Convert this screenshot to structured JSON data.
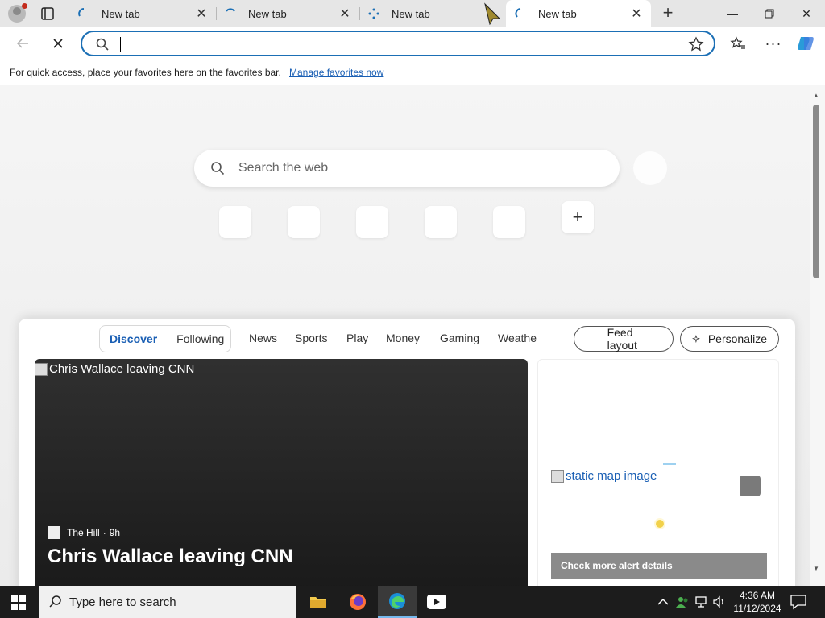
{
  "tabs": [
    {
      "label": "New tab",
      "active": false
    },
    {
      "label": "New tab",
      "active": false
    },
    {
      "label": "New tab",
      "active": false
    },
    {
      "label": "New tab",
      "active": true
    }
  ],
  "address_bar": {
    "value": "",
    "placeholder": ""
  },
  "favorites_bar": {
    "message": "For quick access, place your favorites here on the favorites bar.",
    "link": "Manage favorites now"
  },
  "newtab": {
    "search_placeholder": "Search the web"
  },
  "feed": {
    "primary_tabs": [
      {
        "label": "Discover",
        "selected": true
      },
      {
        "label": "Following",
        "selected": false
      }
    ],
    "tabs": [
      "News",
      "Sports",
      "Play",
      "Money",
      "Gaming",
      "Weathe"
    ],
    "feed_layout_button": "Feed layout",
    "personalize_button": "Personalize",
    "hero": {
      "image_alt": "Chris Wallace leaving CNN",
      "source": "The Hill",
      "age": "9h",
      "headline": "Chris Wallace leaving CNN"
    },
    "side_card": {
      "map_alt": "static map image",
      "alert_button": "Check more alert details"
    }
  },
  "taskbar": {
    "search_placeholder": "Type here to search",
    "time": "4:36 AM",
    "date": "11/12/2024"
  },
  "colors": {
    "accent": "#1b6fb5",
    "link": "#1a5fb4",
    "taskbar": "#1c1c1c"
  }
}
